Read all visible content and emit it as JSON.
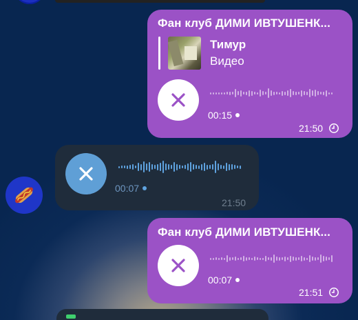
{
  "messages": [
    {
      "direction": "out",
      "sender": "Фан клуб ДИМИ ИВТУШЕНК...",
      "reply": {
        "name": "Тимур",
        "text": "Видео"
      },
      "duration": "00:15",
      "time": "21:50",
      "status_icon": "clock-icon",
      "play_icon": "close-x-icon"
    },
    {
      "direction": "in",
      "duration": "00:07",
      "time": "21:50",
      "avatar_icon": "hotdog-icon",
      "play_icon": "close-x-icon"
    },
    {
      "direction": "out",
      "sender": "Фан клуб ДИМИ ИВТУШЕНК...",
      "duration": "00:07",
      "time": "21:51",
      "status_icon": "clock-icon",
      "play_icon": "close-x-icon"
    }
  ],
  "colors": {
    "outgoing_bubble": "#9b52c6",
    "incoming_bubble": "#1f2c3b",
    "incoming_accent": "#5f9fd6",
    "background": "#082650"
  }
}
